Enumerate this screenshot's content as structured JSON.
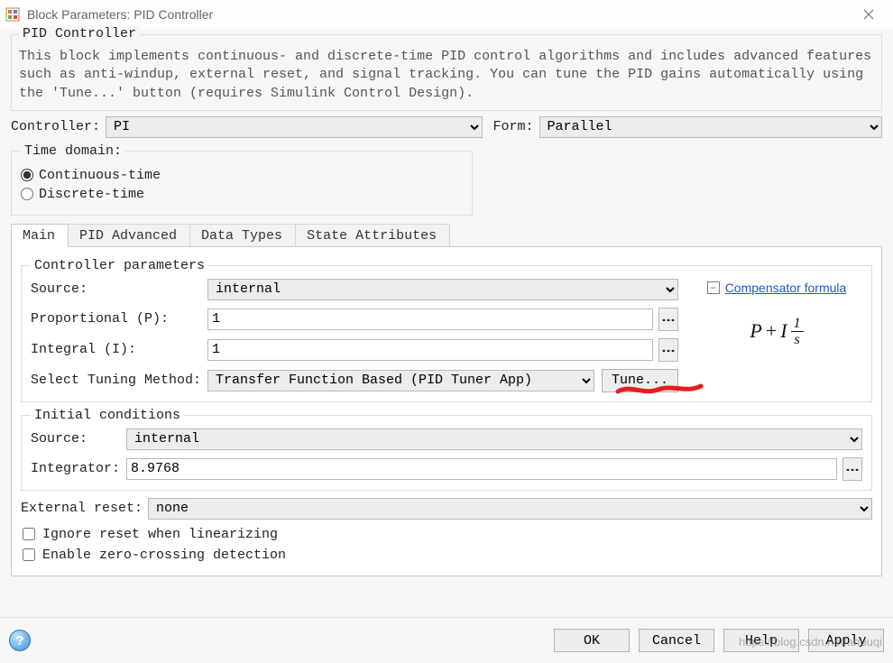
{
  "window": {
    "title": "Block Parameters: PID Controller"
  },
  "header": {
    "group_title": "PID Controller",
    "description": "This block implements continuous- and discrete-time PID control algorithms and includes advanced features such as anti-windup, external reset, and signal tracking. You can tune the PID gains automatically using the 'Tune...' button (requires Simulink Control Design)."
  },
  "top": {
    "controller_label": "Controller:",
    "controller_value": "PI",
    "form_label": "Form:",
    "form_value": "Parallel"
  },
  "time_domain": {
    "legend": "Time domain:",
    "continuous_label": "Continuous-time",
    "discrete_label": "Discrete-time",
    "selected": "continuous"
  },
  "tabs": {
    "main": "Main",
    "pid_advanced": "PID Advanced",
    "data_types": "Data Types",
    "state_attributes": "State Attributes",
    "active": "main"
  },
  "controller_params": {
    "legend": "Controller parameters",
    "source_label": "Source:",
    "source_value": "internal",
    "p_label": "Proportional (P):",
    "p_value": "1",
    "i_label": "Integral (I):",
    "i_value": "1",
    "method_label": "Select Tuning Method:",
    "method_value": "Transfer Function Based (PID Tuner App)",
    "tune_label": "Tune...",
    "compensator_link": "Compensator formula",
    "formula": {
      "P": "P",
      "plus": "+",
      "I": "I",
      "num": "1",
      "den": "s"
    }
  },
  "initial_conditions": {
    "legend": "Initial conditions",
    "source_label": "Source:",
    "source_value": "internal",
    "integrator_label": "Integrator:",
    "integrator_value": "8.9768"
  },
  "external_reset": {
    "label": "External reset:",
    "value": "none"
  },
  "checkboxes": {
    "ignore_label": "Ignore reset when linearizing",
    "ignore_checked": false,
    "zero_label": "Enable zero-crossing detection",
    "zero_checked": false
  },
  "buttons": {
    "ok": "OK",
    "cancel": "Cancel",
    "help": "Help",
    "apply": "Apply"
  },
  "watermark": "https://blog.csdn.net/anbuqi"
}
